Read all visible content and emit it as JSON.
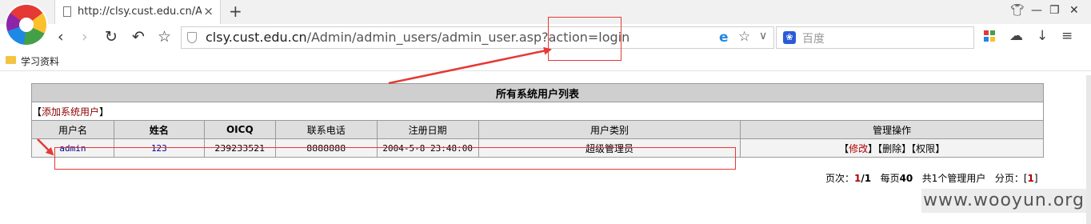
{
  "browser": {
    "tab_title": "http://clsy.cust.edu.cn/Admin/admin_users/admin_user.asp?action=login",
    "tab_close": "×",
    "new_tab": "+",
    "url_host": "clsy.cust.edu.cn",
    "url_path": "/Admin/admin_users/admin_user.asp?action=login",
    "search_placeholder": "百度",
    "bookmark_label": "学习资料",
    "icons": [
      "back-icon",
      "forward-icon",
      "reload-icon",
      "undo-icon",
      "star-icon",
      "shield-icon",
      "ie-icon",
      "dropdown-icon",
      "paw-icon",
      "apps-icon",
      "cloud-icon",
      "download-icon",
      "menu-icon"
    ]
  },
  "table": {
    "title": "所有系统用户列表",
    "add_user_prefix": "【",
    "add_user_label": "添加系统用户",
    "add_user_suffix": "】",
    "headers": [
      "用户名",
      "姓名",
      "OICQ",
      "联系电话",
      "注册日期",
      "用户类别",
      "管理操作"
    ],
    "rows": [
      {
        "username": "admin",
        "name": "123",
        "oicq": "239233521",
        "phone": "8888888",
        "reg_date": "2004-5-8 23:48:00",
        "category": "超级管理员",
        "actions": {
          "edit": "修改",
          "delete": "删除",
          "permission": "权限"
        }
      }
    ]
  },
  "pager": {
    "page_label": "页次：",
    "page_current": "1",
    "page_total": "/1",
    "per_page_label": "每页",
    "per_page": "40",
    "total_label": "共1个管理用户",
    "pages_label": "分页：[",
    "page_link": "1",
    "pages_suffix": "]"
  },
  "watermark": "www.wooyun.org",
  "colors": {
    "annotation": "#e53935",
    "link_red": "#b00000",
    "link_blue": "#00008b"
  }
}
